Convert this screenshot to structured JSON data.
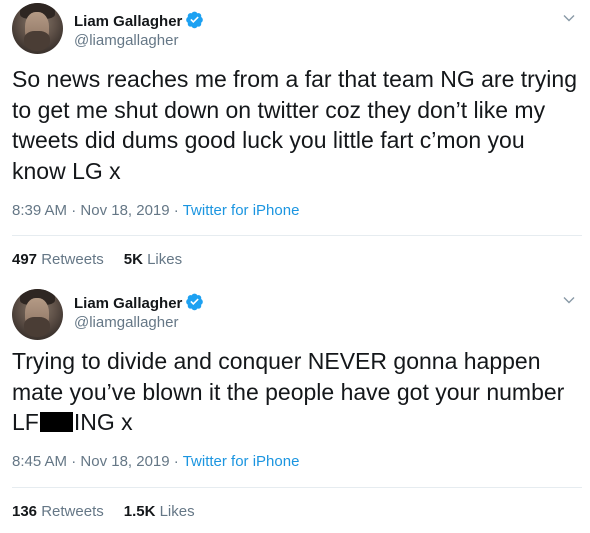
{
  "tweets": [
    {
      "author_name": "Liam Gallagher",
      "author_handle": "@liamgallagher",
      "text": "So news reaches me from a far that team NG are trying to get me shut down on twitter coz they don’t like my tweets did dums good luck you little fart c’mon you know LG x",
      "time": "8:39 AM",
      "date": "Nov 18, 2019",
      "source": "Twitter for iPhone",
      "retweet_count": "497",
      "retweet_label": "Retweets",
      "like_count": "5K",
      "like_label": "Likes"
    },
    {
      "author_name": "Liam Gallagher",
      "author_handle": "@liamgallagher",
      "text_before_redaction": "Trying to divide and conquer NEVER gonna happen mate you’ve blown it the people have got your number LF",
      "text_after_redaction": "ING x",
      "time": "8:45 AM",
      "date": "Nov 18, 2019",
      "source": "Twitter for iPhone",
      "retweet_count": "136",
      "retweet_label": "Retweets",
      "like_count": "1.5K",
      "like_label": "Likes"
    }
  ],
  "separator": " · ",
  "icons": {
    "verified": "verified-badge-icon",
    "menu": "chevron-down-icon"
  },
  "colors": {
    "text": "#14171a",
    "secondary": "#657786",
    "link": "#1b95e0",
    "verified": "#1da1f2",
    "divider": "#e6ecf0"
  }
}
